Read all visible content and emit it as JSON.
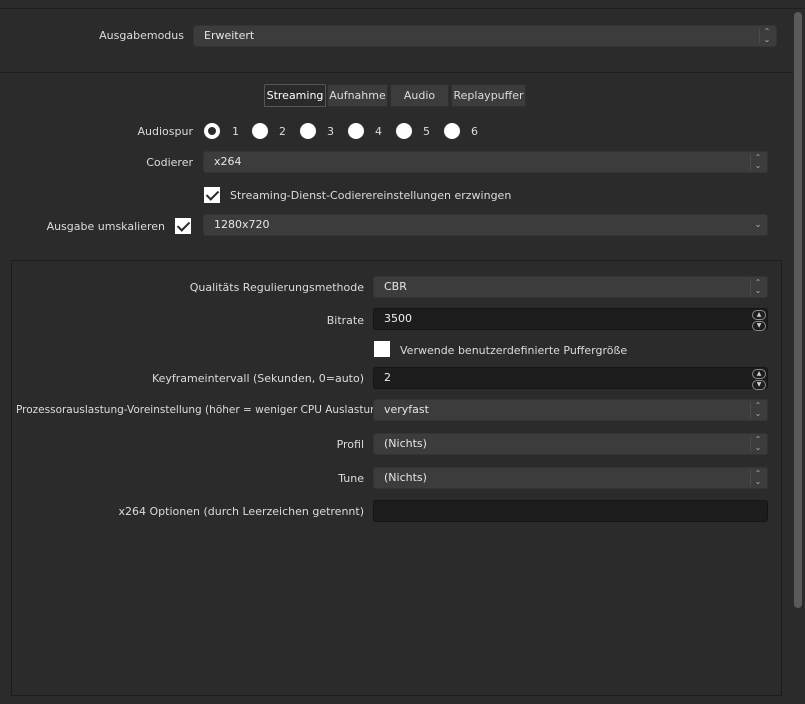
{
  "output_mode": {
    "label": "Ausgabemodus",
    "value": "Erweitert"
  },
  "tabs": [
    {
      "label": "Streaming",
      "active": true
    },
    {
      "label": "Aufnahme",
      "active": false
    },
    {
      "label": "Audio",
      "active": false
    },
    {
      "label": "Replaypuffer",
      "active": false
    }
  ],
  "audiospur": {
    "label": "Audiospur",
    "options": [
      "1",
      "2",
      "3",
      "4",
      "5",
      "6"
    ],
    "selected": "1"
  },
  "encoder": {
    "label": "Codierer",
    "value": "x264"
  },
  "enforce_service": {
    "label": "Streaming-Dienst-Codierereinstellungen erzwingen",
    "checked": true
  },
  "rescale": {
    "label": "Ausgabe umskalieren",
    "checked": true,
    "value": "1280x720"
  },
  "rate_control": {
    "label": "Qualitäts Regulierungsmethode",
    "value": "CBR"
  },
  "bitrate": {
    "label": "Bitrate",
    "value": "3500"
  },
  "custom_buffer": {
    "label": "Verwende benutzerdefinierte Puffergröße",
    "checked": false
  },
  "keyframe": {
    "label": "Keyframeintervall (Sekunden, 0=auto)",
    "value": "2"
  },
  "preset": {
    "label": "Prozessorauslastung-Voreinstellung (höher = weniger CPU Auslastung)",
    "value": "veryfast"
  },
  "profile": {
    "label": "Profil",
    "value": "(Nichts)"
  },
  "tune": {
    "label": "Tune",
    "value": "(Nichts)"
  },
  "x264opts": {
    "label": "x264 Optionen (durch Leerzeichen getrennt)",
    "value": ""
  },
  "icons": {
    "spin_up": "chevron-up-icon",
    "spin_down": "chevron-down-icon",
    "combo": "updown-icon"
  }
}
